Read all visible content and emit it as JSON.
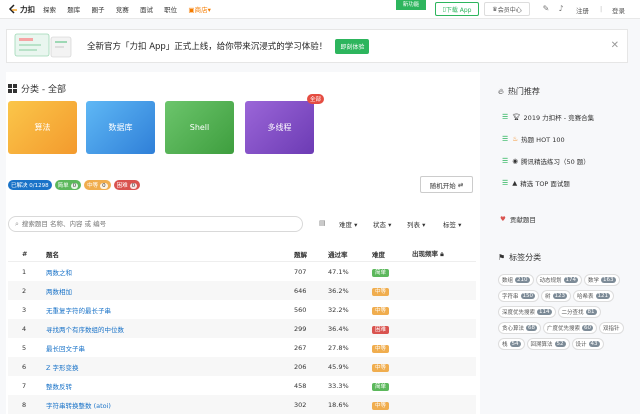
{
  "brand": {
    "name": "力扣"
  },
  "nav": {
    "items": [
      "探索",
      "题库",
      "圈子",
      "竞赛",
      "面试",
      "职位"
    ],
    "shop": "商店"
  },
  "topbar": {
    "new_label": "新功能",
    "download_app": "下载 App",
    "vip": "会员中心",
    "register": "注册",
    "login": "登录"
  },
  "banner": {
    "text": "全新官方「力扣 App」正式上线，给你带来沉浸式的学习体验！",
    "button": "即刻体验"
  },
  "categories": {
    "title": "分类 - 全部",
    "badge": "全部",
    "items": [
      "算法",
      "数据库",
      "Shell",
      "多线程"
    ]
  },
  "stats": {
    "solved": {
      "label": "已解决",
      "value": "0/1298"
    },
    "easy": {
      "label": "简单",
      "value": "0"
    },
    "medium": {
      "label": "中等",
      "value": "0"
    },
    "hard": {
      "label": "困难",
      "value": "0"
    }
  },
  "random_button": "随机开始",
  "search": {
    "placeholder": "搜索题目 名称、内容 或 编号"
  },
  "filters": [
    "难度",
    "状态",
    "列表",
    "标签"
  ],
  "table": {
    "headers": [
      "#",
      "题名",
      "题解",
      "通过率",
      "难度",
      "出现频率"
    ],
    "rows": [
      {
        "num": "1",
        "title": "两数之和",
        "solutions": "707",
        "rate": "47.1%",
        "difficulty": "简单"
      },
      {
        "num": "2",
        "title": "两数相加",
        "solutions": "646",
        "rate": "36.2%",
        "difficulty": "中等"
      },
      {
        "num": "3",
        "title": "无重复字符的最长子串",
        "solutions": "560",
        "rate": "32.2%",
        "difficulty": "中等"
      },
      {
        "num": "4",
        "title": "寻找两个有序数组的中位数",
        "solutions": "299",
        "rate": "36.4%",
        "difficulty": "困难"
      },
      {
        "num": "5",
        "title": "最长回文子串",
        "solutions": "267",
        "rate": "27.8%",
        "difficulty": "中等"
      },
      {
        "num": "6",
        "title": "Z 字形变换",
        "solutions": "206",
        "rate": "45.9%",
        "difficulty": "中等"
      },
      {
        "num": "7",
        "title": "整数反转",
        "solutions": "458",
        "rate": "33.3%",
        "difficulty": "简单"
      },
      {
        "num": "8",
        "title": "字符串转换整数 (atoi)",
        "solutions": "302",
        "rate": "18.6%",
        "difficulty": "中等"
      }
    ]
  },
  "sidebar": {
    "hot_title": "热门推荐",
    "hot_items": [
      "2019 力扣杯 - 竞赛合集",
      "热题 HOT 100",
      "腾讯精选练习（50 题）",
      "精选 TOP 面试题"
    ],
    "contribute": "贡献题目",
    "tags_title": "标签分类",
    "tags": [
      {
        "name": "数组",
        "count": "210"
      },
      {
        "name": "动态规划",
        "count": "174"
      },
      {
        "name": "数学",
        "count": "163"
      },
      {
        "name": "字符串",
        "count": "150"
      },
      {
        "name": "树",
        "count": "123"
      },
      {
        "name": "哈希表",
        "count": "121"
      },
      {
        "name": "深度优先搜索",
        "count": "114"
      },
      {
        "name": "二分查找",
        "count": "81"
      },
      {
        "name": "贪心算法",
        "count": "68"
      },
      {
        "name": "广度优先搜索",
        "count": "60"
      },
      {
        "name": "双指针",
        "count": ""
      },
      {
        "name": "栈",
        "count": "54"
      },
      {
        "name": "回溯算法",
        "count": "52"
      },
      {
        "name": "设计",
        "count": "43"
      }
    ]
  },
  "colors": {
    "green": "#2db55d",
    "easy": "#5cb85c",
    "medium": "#f0ad4e",
    "hard": "#d9534f",
    "blue": "#1a73c8"
  }
}
